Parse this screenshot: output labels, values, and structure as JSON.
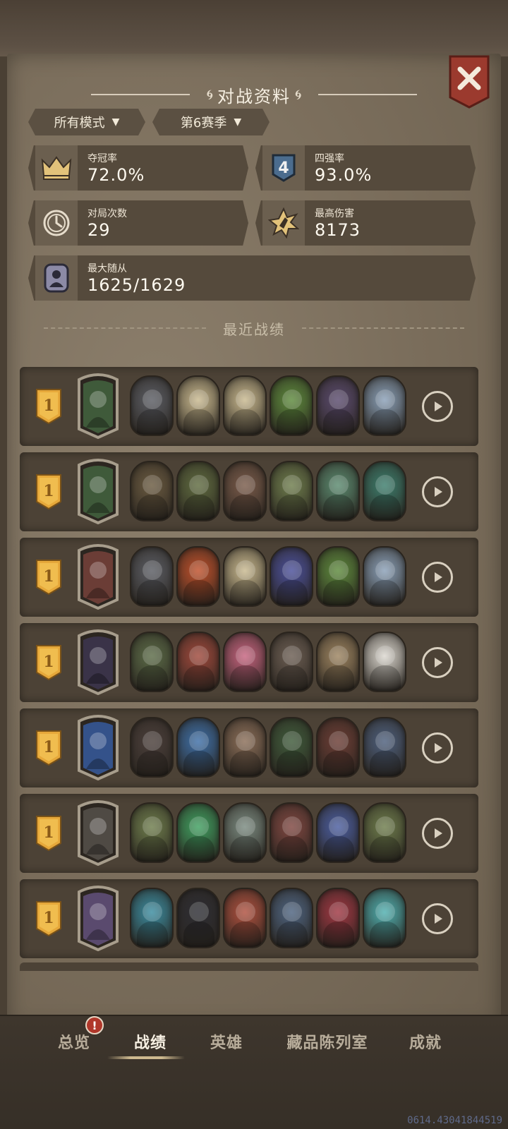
{
  "header": {
    "title": "对战资料",
    "close_icon": "close-icon"
  },
  "filters": {
    "mode": "所有模式",
    "season": "第6赛季"
  },
  "stats": [
    {
      "label": "夺冠率",
      "value": "72.0%",
      "icon": "crown-icon"
    },
    {
      "label": "四强率",
      "value": "93.0%",
      "icon": "top-four-icon"
    },
    {
      "label": "对局次数",
      "value": "29",
      "icon": "clock-icon"
    },
    {
      "label": "最高伤害",
      "value": "8173",
      "icon": "damage-burst-icon"
    },
    {
      "label": "最大随从",
      "value": "1625/1629",
      "icon": "minion-card-icon"
    }
  ],
  "section_title": "最近战绩",
  "records": [
    {
      "rank": "1",
      "hero_color": "#3f5a3a",
      "minions": [
        "#5a5c63",
        "#c9b98f",
        "#c9b98f",
        "#5d8a3c",
        "#5a4a6e",
        "#8aa0b8"
      ]
    },
    {
      "rank": "1",
      "hero_color": "#3f5a3a",
      "minions": [
        "#6a5a40",
        "#5f6b3f",
        "#7a5b4a",
        "#6e7d4c",
        "#5a8a6f",
        "#3c7e6d"
      ]
    },
    {
      "rank": "1",
      "hero_color": "#6b3d36",
      "minions": [
        "#5a5c63",
        "#c0502a",
        "#c9b98f",
        "#4a4f9a",
        "#5d8a3c",
        "#8aa0b8"
      ]
    },
    {
      "rank": "1",
      "hero_color": "#3a3348",
      "minions": [
        "#5b6b47",
        "#a0483b",
        "#c7637f",
        "#6b5d52",
        "#9d8460",
        "#dcd8d0"
      ]
    },
    {
      "rank": "1",
      "hero_color": "#34528a",
      "minions": [
        "#4a3e3a",
        "#3d6fa8",
        "#8b6e58",
        "#3e5a3a",
        "#6b3c34",
        "#4d5f7d"
      ]
    },
    {
      "rank": "1",
      "hero_color": "#4f4a44",
      "minions": [
        "#6e7d4c",
        "#3fa060",
        "#7a8a80",
        "#7f4640",
        "#4a5da0",
        "#6e7d4c"
      ]
    },
    {
      "rank": "1",
      "hero_color": "#5a4a6e",
      "minions": [
        "#3a8ca0",
        "#2d2d33",
        "#b0503e",
        "#4d6380",
        "#a03642",
        "#4fb0b0"
      ]
    }
  ],
  "bottom_nav": {
    "items": [
      "总览",
      "战绩",
      "英雄",
      "藏品陈列室",
      "成就"
    ],
    "active": "战绩",
    "alert_badge": "!"
  },
  "watermark": "0614.43041844519",
  "colors": {
    "panel": "#7a6d5b",
    "card": "#554a3c",
    "rank_gold": "#e6a83a",
    "close_red": "#9b3a2e"
  }
}
